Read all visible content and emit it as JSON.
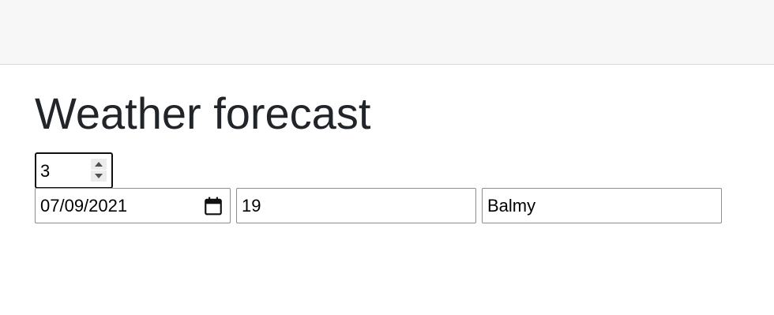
{
  "header": {
    "background": "#f7f7f7"
  },
  "main": {
    "title": "Weather forecast",
    "count_input": {
      "value": "3"
    },
    "forecast_row": {
      "date": "07/09/2021",
      "temperature": "19",
      "summary": "Balmy"
    },
    "icons": {
      "calendar": "calendar-icon",
      "spinner_up": "chevron-up-icon",
      "spinner_down": "chevron-down-icon"
    }
  }
}
